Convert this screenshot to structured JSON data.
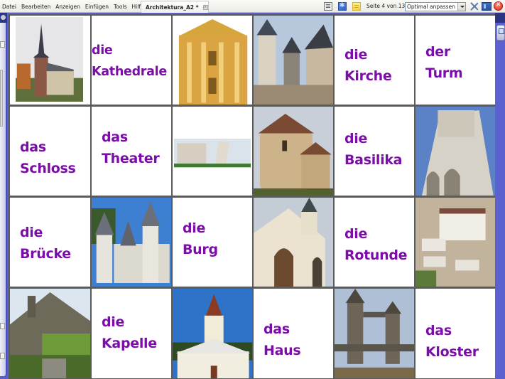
{
  "menu": [
    "Datei",
    "Bearbeiten",
    "Anzeigen",
    "Einfügen",
    "Tools",
    "Hilfe"
  ],
  "document_tab": {
    "label": "Architektura_A2 *"
  },
  "toolbar": {
    "page_indicator": "Seite 4 von 13",
    "zoom_select": {
      "value": "Optimal anpassen"
    },
    "icons": [
      "page-view-icon",
      "snowflake-icon",
      "sticky-note-icon",
      "fit-screen-icon",
      "board-icon",
      "close-icon"
    ]
  },
  "tiles": [
    {
      "type": "image",
      "subject": "church with spire"
    },
    {
      "type": "word",
      "article": "die",
      "noun": "Kathedrale"
    },
    {
      "type": "image",
      "subject": "theater facade"
    },
    {
      "type": "image",
      "subject": "castle Karlštejn"
    },
    {
      "type": "word",
      "article": "die",
      "noun": "Kirche"
    },
    {
      "type": "word",
      "article": "der",
      "noun": "Turm"
    },
    {
      "type": "word",
      "article": "das",
      "noun": "Schloss"
    },
    {
      "type": "word",
      "article": "das",
      "noun": "Theater"
    },
    {
      "type": "image",
      "subject": "leaning tower of Pisa"
    },
    {
      "type": "image",
      "subject": "rotunda"
    },
    {
      "type": "word",
      "article": "die",
      "noun": "Basilika"
    },
    {
      "type": "image",
      "subject": "gothic cathedral"
    },
    {
      "type": "word",
      "article": "die",
      "noun": "Brücke"
    },
    {
      "type": "image",
      "subject": "fairy-tale palace"
    },
    {
      "type": "word",
      "article": "die",
      "noun": "Burg"
    },
    {
      "type": "image",
      "subject": "chapel"
    },
    {
      "type": "word",
      "article": "die",
      "noun": "Rotunde"
    },
    {
      "type": "image",
      "subject": "mountain monastery"
    },
    {
      "type": "image",
      "subject": "stone house"
    },
    {
      "type": "word",
      "article": "die",
      "noun": "Kapelle"
    },
    {
      "type": "image",
      "subject": "baroque church"
    },
    {
      "type": "word",
      "article": "das",
      "noun": "Haus"
    },
    {
      "type": "image",
      "subject": "tower bridge"
    },
    {
      "type": "word",
      "article": "das",
      "noun": "Kloster"
    }
  ],
  "colors": {
    "word_text": "#7b0ea8",
    "grid": "#5b5b5b",
    "frame": "#5a5fd0"
  }
}
